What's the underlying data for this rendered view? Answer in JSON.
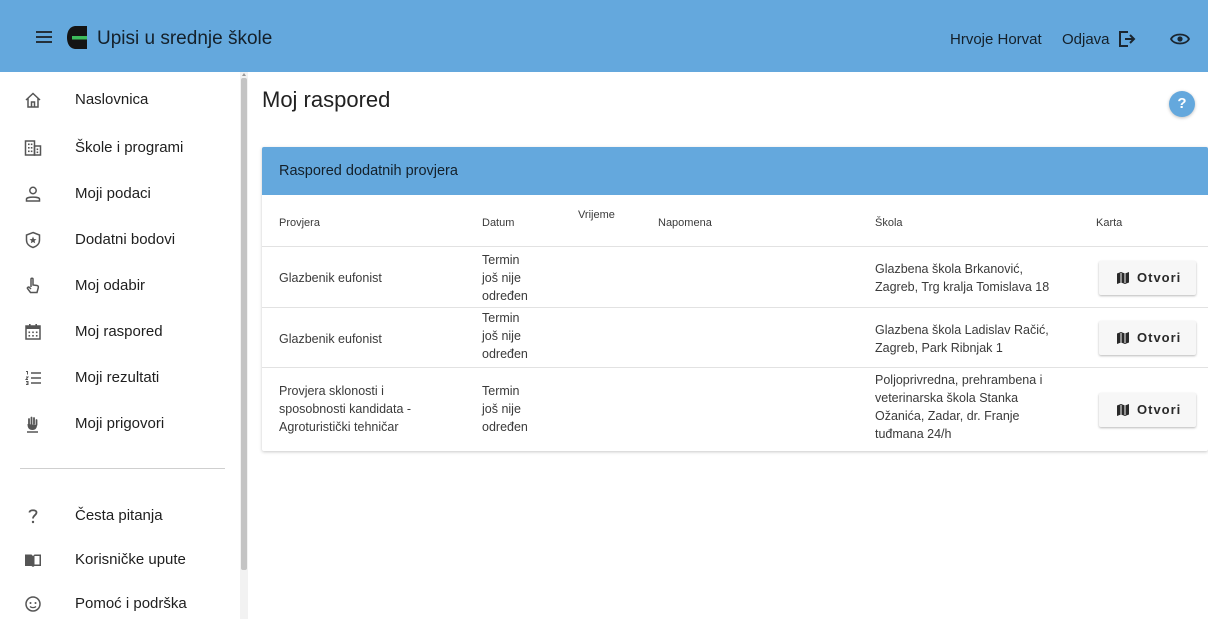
{
  "header": {
    "app_title": "Upisi u srednje škole",
    "user_name": "Hrvoje Horvat",
    "logout_label": "Odjava",
    "bar_color": "#64a8dd"
  },
  "sidebar": {
    "items": [
      {
        "label": "Naslovnica",
        "icon": "home-icon"
      },
      {
        "label": "Škole i programi",
        "icon": "building-icon"
      },
      {
        "label": "Moji podaci",
        "icon": "person-icon"
      },
      {
        "label": "Dodatni bodovi",
        "icon": "star-badge-icon"
      },
      {
        "label": "Moj odabir",
        "icon": "pointer-hand-icon"
      },
      {
        "label": "Moj raspored",
        "icon": "calendar-icon"
      },
      {
        "label": "Moji rezultati",
        "icon": "ordered-list-icon"
      },
      {
        "label": "Moji prigovori",
        "icon": "raised-hand-icon"
      }
    ],
    "secondary_items": [
      {
        "label": "Česta pitanja",
        "icon": "question-icon"
      },
      {
        "label": "Korisničke upute",
        "icon": "book-icon"
      },
      {
        "label": "Pomoć i podrška",
        "icon": "support-icon"
      }
    ]
  },
  "main": {
    "page_title": "Moj raspored",
    "help_label": "?",
    "card_title": "Raspored dodatnih provjera",
    "columns": [
      "Provjera",
      "Datum",
      "Vrijeme",
      "Napomena",
      "Škola",
      "Karta"
    ],
    "rows": [
      {
        "provjera": [
          "Glazbenik eufonist"
        ],
        "datum": [
          "Termin",
          "još nije",
          "određen"
        ],
        "vrijeme": "",
        "napomena": "",
        "skola": [
          "Glazbena škola Brkanović,",
          "Zagreb, Trg kralja Tomislava 18"
        ],
        "button": "Otvori"
      },
      {
        "provjera": [
          "Glazbenik eufonist"
        ],
        "datum": [
          "Termin",
          "još nije",
          "određen"
        ],
        "vrijeme": "",
        "napomena": "",
        "skola": [
          "Glazbena škola Ladislav Račić,",
          "Zagreb, Park Ribnjak 1"
        ],
        "button": "Otvori"
      },
      {
        "provjera": [
          "Provjera sklonosti i",
          "sposobnosti kandidata -",
          "Agroturistički tehničar"
        ],
        "datum": [
          "Termin",
          "još nije",
          "određen"
        ],
        "vrijeme": "",
        "napomena": "",
        "skola": [
          "Poljoprivredna, prehrambena i",
          "veterinarska škola Stanka",
          "Ožanića, Zadar, dr. Franje",
          "tuđmana 24/h"
        ],
        "button": "Otvori"
      }
    ]
  }
}
